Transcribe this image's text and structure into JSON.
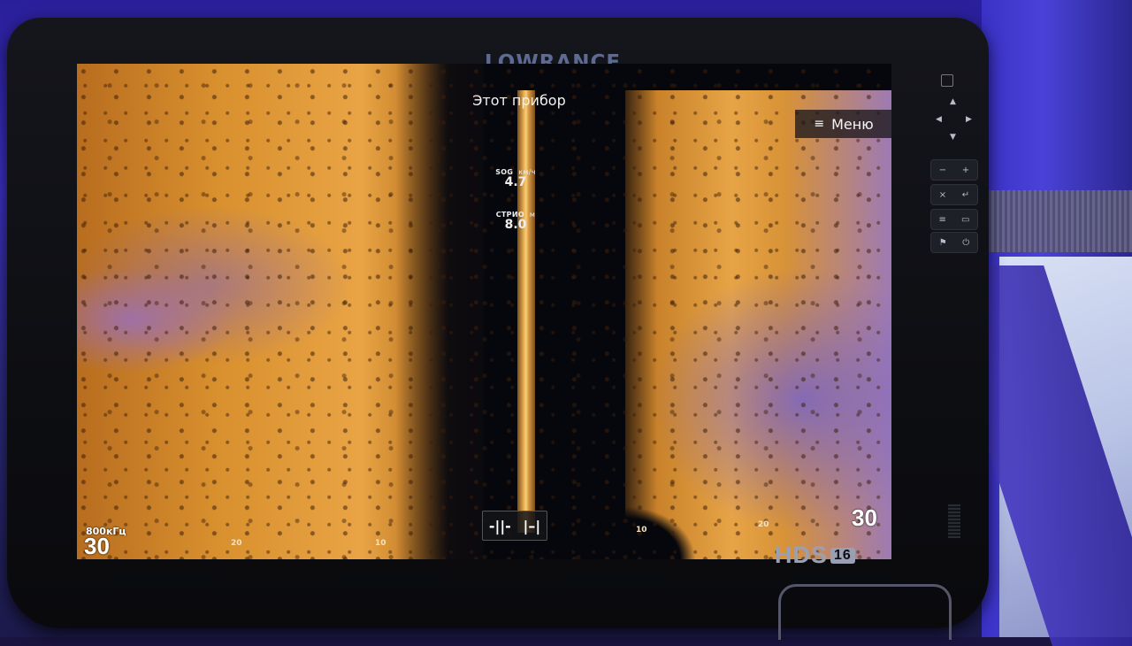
{
  "device": {
    "brand": "LOWRANCE",
    "model": "HDS",
    "model_size": "16"
  },
  "screen": {
    "source_title": "Этот прибор",
    "menu_label": "Меню",
    "menu_icon": "hamburger-icon",
    "readouts": [
      {
        "label": "SOG",
        "unit": "км/ч",
        "value": "4.7"
      },
      {
        "label": "СТРИО",
        "unit": "м",
        "value": "8.0"
      }
    ],
    "left_range": "30",
    "right_range": "30",
    "frequency": "800кГц",
    "range_ticks": [
      "20",
      "10",
      "10",
      "20"
    ],
    "range_control": {
      "zoom_in_icon": "range-narrow-icon",
      "zoom_out_icon": "range-wide-icon",
      "zoom_in": "-||-",
      "zoom_out": "|–|"
    }
  },
  "keypad": {
    "dpad": {
      "up": "▲",
      "down": "▼",
      "left": "◀",
      "right": "▶"
    },
    "keys": [
      {
        "icon": "minus-icon",
        "alt_icon": "plus-icon",
        "a": "−",
        "b": "+"
      },
      {
        "icon": "close-icon",
        "alt_icon": "enter-icon",
        "a": "×",
        "b": "↵"
      },
      {
        "icon": "menu-icon",
        "alt_icon": "pages-icon",
        "a": "≡",
        "b": "▭"
      },
      {
        "icon": "waypoint-icon",
        "alt_icon": "power-icon",
        "a": "⚑",
        "b": "⏻"
      }
    ]
  },
  "colors": {
    "sonar_bright": "#e9a445",
    "sonar_dark": "#b86d1f",
    "bezel": "#0d0e12",
    "brand_text": "#5d6a94",
    "tent": "#3b2fc0"
  }
}
